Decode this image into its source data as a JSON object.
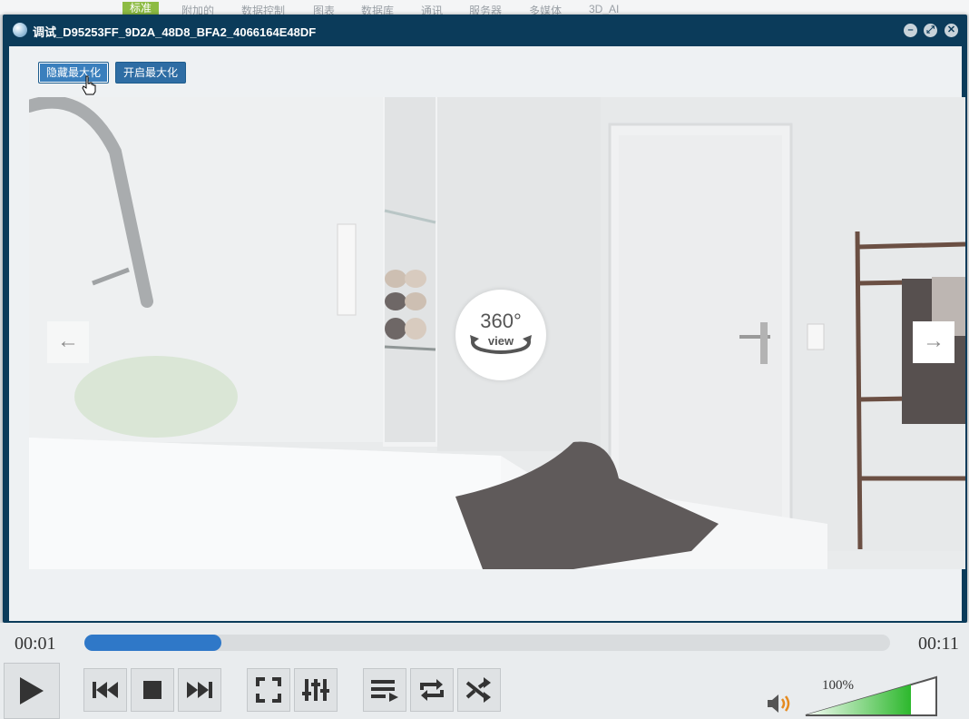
{
  "background_app": {
    "tabs": [
      "标准",
      "附加的",
      "数据控制",
      "图表",
      "数据库",
      "通讯",
      "服务器",
      "多媒体",
      "3D_AI"
    ],
    "active_tab_index": 0
  },
  "dialog": {
    "title": "调试_D95253FF_9D2A_48D8_BFA2_4066164E48DF",
    "buttons": {
      "hide_maximize": "隐藏最大化",
      "open_maximize": "开启最大化"
    },
    "viewer": {
      "badge_degrees": "360°",
      "badge_view": "view",
      "prev_arrow": "←",
      "next_arrow": "→"
    }
  },
  "player": {
    "current_time": "00:01",
    "total_time": "00:11",
    "progress_fraction": 0.17,
    "volume_label": "100%",
    "volume_fraction": 1.0,
    "accent_color": "#2f78c8",
    "volume_color": "#2db82d",
    "controls": [
      "play-icon",
      "previous-icon",
      "stop-icon",
      "next-icon",
      "fullscreen-icon",
      "equalizer-icon",
      "playlist-icon",
      "repeat-icon",
      "shuffle-icon",
      "speaker-icon"
    ]
  }
}
